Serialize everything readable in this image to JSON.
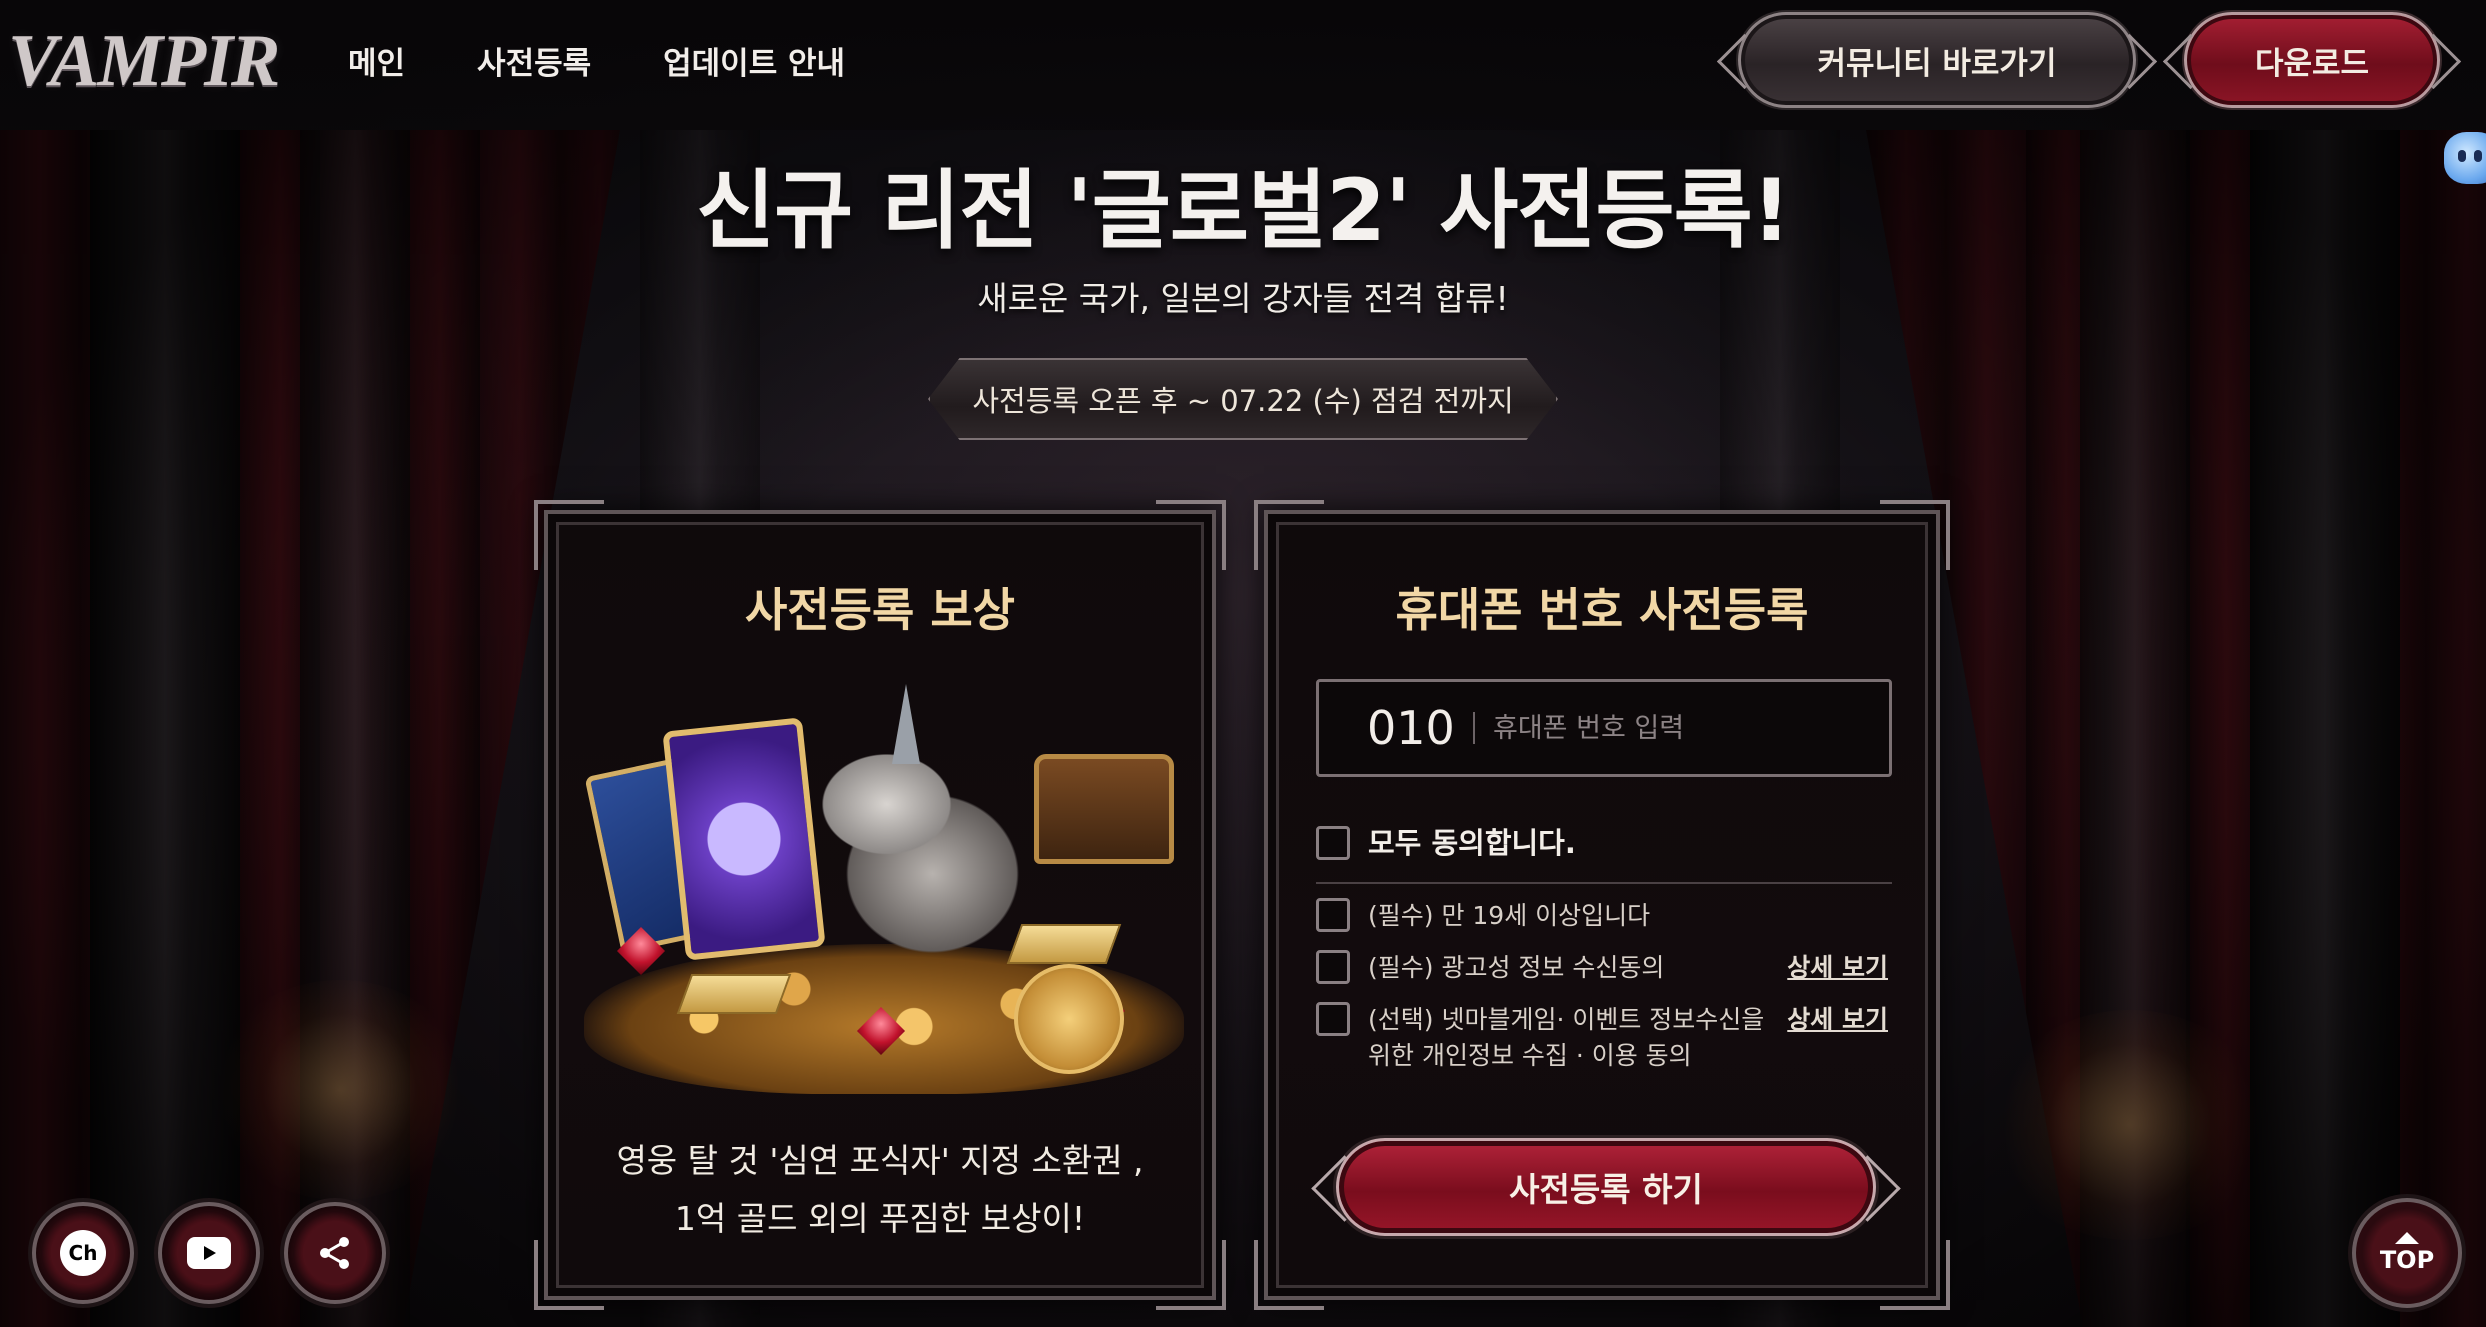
{
  "header": {
    "logo": "VAMPIR",
    "nav": [
      "메인",
      "사전등록",
      "업데이트 안내"
    ],
    "community_button": "커뮤니티 바로가기",
    "download_button": "다운로드"
  },
  "hero": {
    "title": "신규 리전 '글로벌2' 사전등록!",
    "subtitle": "새로운 국가, 일본의 강자들 전격 합류!",
    "period": "사전등록 오픈 후 ~ 07.22 (수) 점검 전까지"
  },
  "reward_panel": {
    "title": "사전등록 보상",
    "text_line1": "영웅 탈 것 '심연 포식자' 지정 소환권 ,",
    "text_line2": "1억 골드 외의 푸짐한 보상이!"
  },
  "register_panel": {
    "title": "휴대폰 번호 사전등록",
    "phone_prefix": "010",
    "phone_placeholder": "휴대폰 번호 입력",
    "agree_all": "모두 동의합니다.",
    "agreements": [
      {
        "label": "(필수) 만 19세 이상입니다",
        "detail": ""
      },
      {
        "label": "(필수) 광고성 정보 수신동의",
        "detail": "상세 보기"
      },
      {
        "label": "(선택) 넷마블게임· 이벤트 정보수신을 위한 개인정보 수집 · 이용 동의",
        "detail": "상세 보기"
      }
    ],
    "submit": "사전등록 하기"
  },
  "social": {
    "channel_label": "Ch",
    "icons": [
      "kakao-channel-icon",
      "youtube-icon",
      "share-icon"
    ]
  },
  "top_button": "TOP",
  "colors": {
    "accent_red": "#9c1a2d",
    "gold_title": "#f1d7a6",
    "panel_bg": "#110b0d"
  }
}
